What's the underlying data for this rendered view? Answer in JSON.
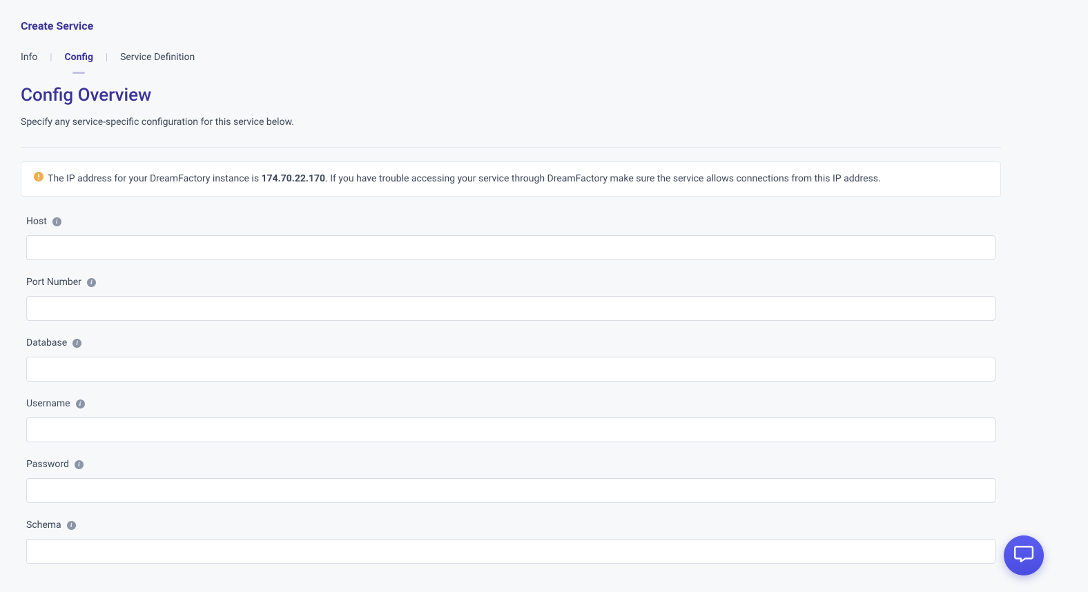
{
  "header": {
    "title": "Create Service"
  },
  "tabs": {
    "info": "Info",
    "config": "Config",
    "service_definition": "Service Definition",
    "separator": "|"
  },
  "section": {
    "heading": "Config Overview",
    "description": "Specify any service-specific configuration for this service below."
  },
  "banner": {
    "text_pre": "The IP address for your DreamFactory instance is ",
    "ip": "174.70.22.170",
    "text_post": ". If you have trouble accessing your service through DreamFactory make sure the service allows connections from this IP address."
  },
  "fields": {
    "host": {
      "label": "Host",
      "value": ""
    },
    "port": {
      "label": "Port Number",
      "value": ""
    },
    "database": {
      "label": "Database",
      "value": ""
    },
    "username": {
      "label": "Username",
      "value": ""
    },
    "password": {
      "label": "Password",
      "value": ""
    },
    "schema": {
      "label": "Schema",
      "value": ""
    }
  },
  "info_icon_glyph": "i"
}
